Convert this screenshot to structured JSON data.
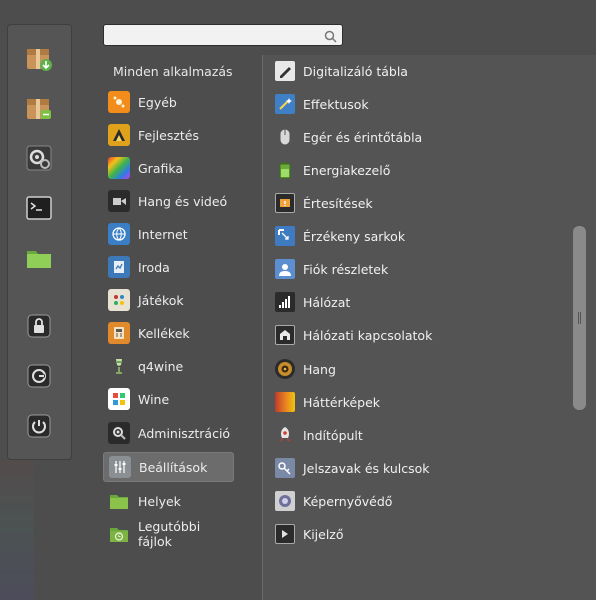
{
  "search": {
    "placeholder": "",
    "value": ""
  },
  "favorites": [
    {
      "name": "package-installer-icon"
    },
    {
      "name": "package-manager-icon"
    },
    {
      "name": "system-settings-icon"
    },
    {
      "name": "terminal-icon"
    },
    {
      "name": "files-folder-icon"
    },
    {
      "name": "lock-screen-icon"
    },
    {
      "name": "logout-icon"
    },
    {
      "name": "power-off-icon"
    }
  ],
  "categories": {
    "header": "Minden alkalmazás",
    "items": [
      {
        "label": "Egyéb",
        "color": "#f28c1a"
      },
      {
        "label": "Fejlesztés",
        "color": "#e0a11b"
      },
      {
        "label": "Grafika",
        "color": "#d04ac8"
      },
      {
        "label": "Hang és videó",
        "color": "#2b2b2b"
      },
      {
        "label": "Internet",
        "color": "#3a7fc6"
      },
      {
        "label": "Iroda",
        "color": "#3d78b8"
      },
      {
        "label": "Játékok",
        "color": "#e7e2d2"
      },
      {
        "label": "Kellékek",
        "color": "#e08a2c"
      },
      {
        "label": "q4wine",
        "color": "#6aa84f"
      },
      {
        "label": "Wine",
        "color": "#c0392b"
      },
      {
        "label": "Adminisztráció",
        "color": "#5f6a70"
      },
      {
        "label": "Beállítások",
        "color": "#8a8f94"
      },
      {
        "label": "Helyek",
        "color": "#8bc34a"
      },
      {
        "label": "Legutóbbi fájlok",
        "color": "#7cb342"
      }
    ],
    "selected": "Beállítások"
  },
  "apps": [
    {
      "label": "Digitalizáló tábla",
      "icon": "tablet-pen-icon",
      "color": "#e8e8e8"
    },
    {
      "label": "Effektusok",
      "icon": "effects-icon",
      "color": "#3f7fc6"
    },
    {
      "label": "Egér és érintőtábla",
      "icon": "mouse-icon",
      "color": "#d8d8d8"
    },
    {
      "label": "Energiakezelő",
      "icon": "battery-icon",
      "color": "#7cc142"
    },
    {
      "label": "Értesítések",
      "icon": "notification-icon",
      "color": "#f2a23a"
    },
    {
      "label": "Érzékeny sarkok",
      "icon": "hot-corners-icon",
      "color": "#3e7bc1"
    },
    {
      "label": "Fiók részletek",
      "icon": "user-account-icon",
      "color": "#5b8fd0"
    },
    {
      "label": "Hálózat",
      "icon": "network-signal-icon",
      "color": "#2b2b2b"
    },
    {
      "label": "Hálózati kapcsolatok",
      "icon": "network-connections-icon",
      "color": "#2b2b2b"
    },
    {
      "label": "Hang",
      "icon": "speaker-icon",
      "color": "#c88d2b"
    },
    {
      "label": "Háttérképek",
      "icon": "wallpaper-icon",
      "color": "#e6a12e"
    },
    {
      "label": "Indítópult",
      "icon": "startup-icon",
      "color": "#d33b2c"
    },
    {
      "label": "Jelszavak és kulcsok",
      "icon": "keys-icon",
      "color": "#7a8aa6"
    },
    {
      "label": "Képernyővédő",
      "icon": "screensaver-icon",
      "color": "#6f6f9a"
    },
    {
      "label": "Kijelző",
      "icon": "display-icon",
      "color": "#2b2b2b"
    }
  ]
}
